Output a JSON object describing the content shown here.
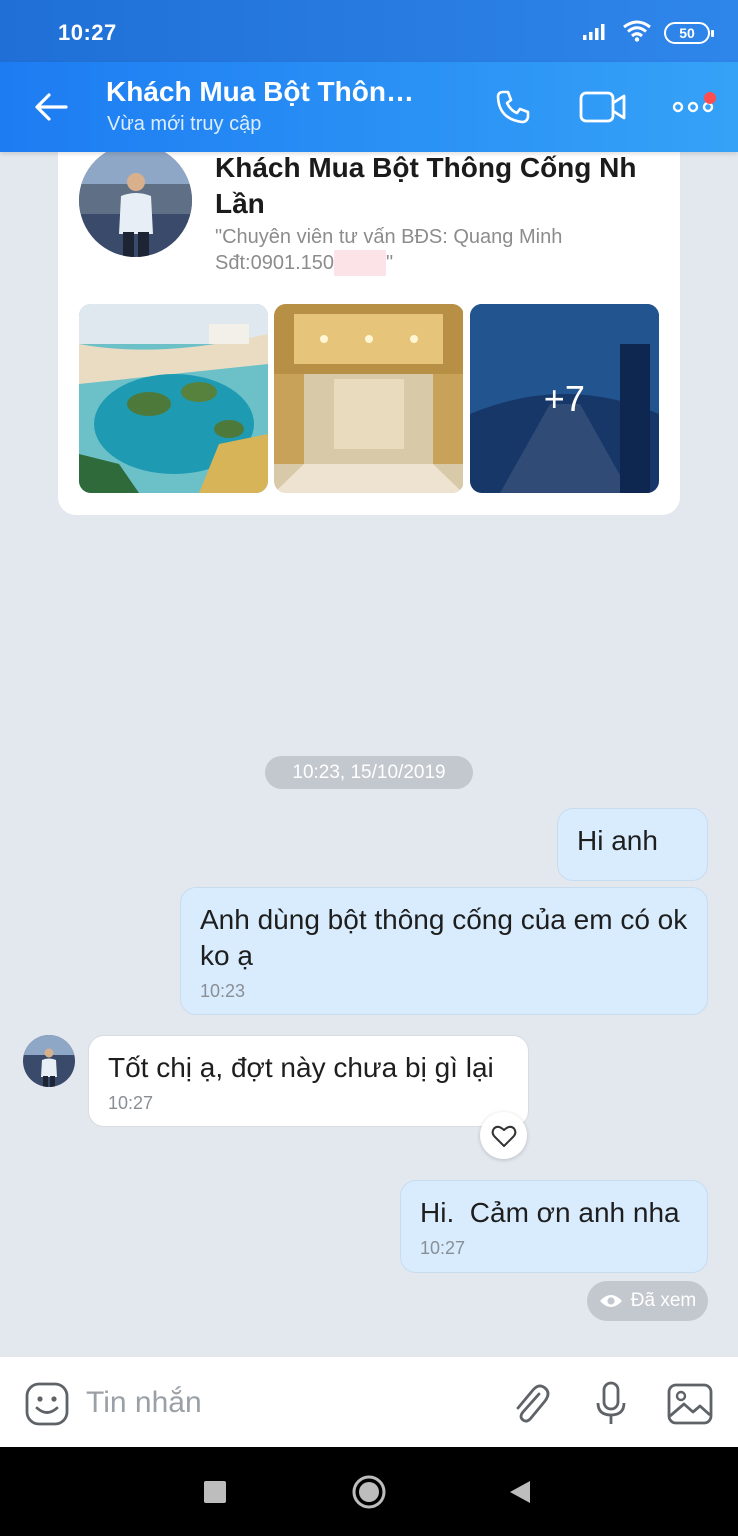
{
  "status_bar": {
    "time": "10:27",
    "battery": "50"
  },
  "header": {
    "title": "Khách Mua Bột Thông Cống Nh Lần",
    "subtitle": "Vừa mới truy cập"
  },
  "profile_card": {
    "name": "Khách Mua Bột Thông Cống Nh Lần",
    "bio_line1": "\"Chuyên viên tư vấn BĐS: Quang Minh",
    "bio_line2_prefix": "Sđt:0901.150",
    "bio_line2_suffix": "\"",
    "more_photos": "+7"
  },
  "chat": {
    "date_divider": "10:23, 15/10/2019",
    "messages": [
      {
        "direction": "out",
        "text": "Hi anh",
        "time": ""
      },
      {
        "direction": "out",
        "text": "Anh dùng bột thông cống của em có ok ko ạ",
        "time": "10:23"
      },
      {
        "direction": "in",
        "text": "Tốt chị ạ, đợt này chưa bị gì lại",
        "time": "10:27"
      },
      {
        "direction": "out",
        "text": "Hi.  Cảm ơn anh nha",
        "time": "10:27"
      }
    ],
    "seen_label": "Đã xem"
  },
  "input": {
    "placeholder": "Tin nhắn"
  },
  "colors": {
    "header": "#1d7cf2",
    "outgoing_bubble": "#d8ecfd",
    "incoming_bubble": "#ffffff",
    "background": "#e3e8ef"
  }
}
